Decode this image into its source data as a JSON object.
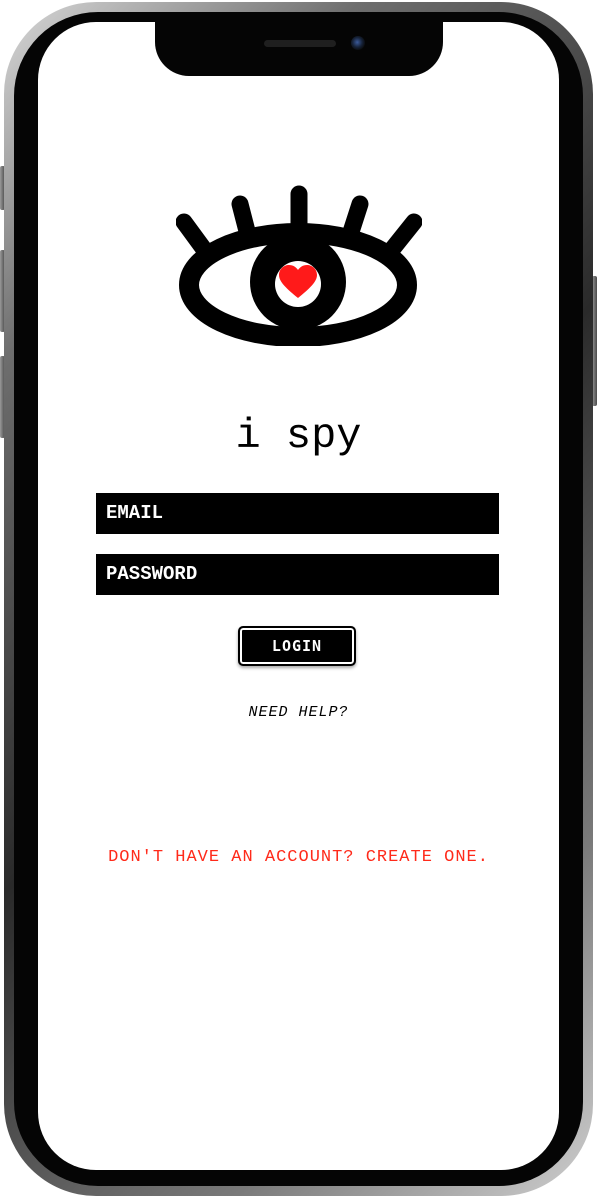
{
  "app": {
    "title": "i spy"
  },
  "logo": {
    "icon": "eye-with-heart-icon",
    "heart_color": "#ff1a1a",
    "ink_color": "#000000"
  },
  "form": {
    "email_placeholder": "EMAIL",
    "password_placeholder": "PASSWORD",
    "login_label": "LOGIN"
  },
  "links": {
    "help": "NEED HELP?",
    "create_account": "DON'T HAVE AN ACCOUNT? CREATE ONE.",
    "create_account_color": "#ff2a1a"
  }
}
